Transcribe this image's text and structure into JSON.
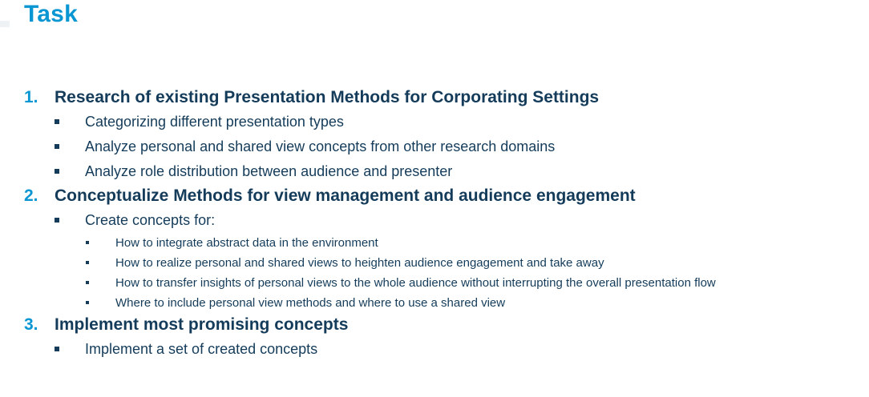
{
  "title": "Task",
  "tasks": [
    {
      "number": "1.",
      "title": "Research of existing Presentation Methods for Corporating Settings",
      "items": [
        {
          "text": "Categorizing different presentation types"
        },
        {
          "text": "Analyze personal and shared view concepts from other research domains"
        },
        {
          "text": "Analyze role distribution between audience and presenter"
        }
      ]
    },
    {
      "number": "2.",
      "title": "Conceptualize Methods for view management and audience engagement",
      "items": [
        {
          "text": "Create concepts for:",
          "subitems": [
            "How to integrate abstract data in the environment",
            "How to realize personal and shared views to heighten audience engagement and take away",
            "How to transfer insights of personal views to the whole audience without interrupting the overall presentation flow",
            "Where to include personal view methods and where to use a shared view"
          ]
        }
      ]
    },
    {
      "number": "3.",
      "title": "Implement most promising concepts",
      "items": [
        {
          "text": "Implement a set of created concepts"
        }
      ]
    }
  ],
  "colors": {
    "accent": "#0a96d2",
    "text": "#143c5a",
    "background": "#ffffff"
  }
}
